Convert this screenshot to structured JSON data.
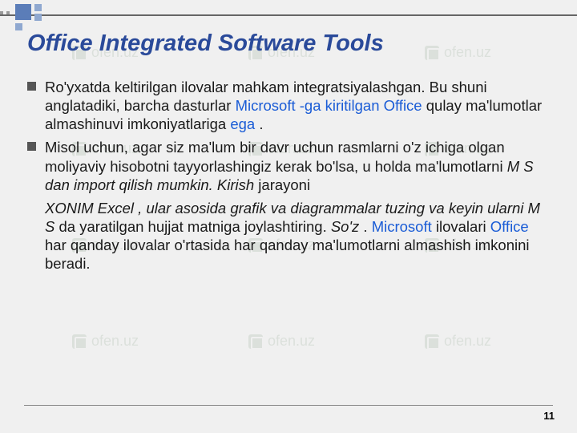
{
  "watermark_text": "ofen.uz",
  "title": "Office Integrated Software Tools",
  "bullets": [
    {
      "pre1": "Ro'yxatda keltirilgan ilovalar mahkam integratsiyalashgan. Bu shuni anglatadiki, barcha dasturlar ",
      "link1": "Microsoft -ga kiritilgan Office",
      "mid1": " qulay ma'lumotlar almashinuvi imkoniyatlariga ",
      "link2": "ega ",
      "post1": "."
    },
    {
      "pre1": "Misol uchun, agar siz ma'lum bir davr uchun rasmlarni o'z ichiga olgan moliyaviy hisobotni tayyorlashingiz kerak bo'lsa, u holda ma'lumotlarni ",
      "italic1": "M S dan import qilish mumkin. Kirish",
      "post1": " jarayoni"
    }
  ],
  "continuation": {
    "italic1": " XONIM Excel , ular ",
    "plain1_italic": "asosida grafik va diagrammalar tuzing va keyin ularni M S ",
    "plain2": "da yaratilgan hujjat matniga joylashtiring. ",
    "italic2": "So'z ",
    "plain3": ". ",
    "link1": "Microsoft",
    "plain4": " ilovalari ",
    "link2": "Office",
    "plain5": " har qanday ilovalar o'rtasida har qanday ma'lumotlarni almashish imkonini beradi."
  },
  "page_number": "11"
}
